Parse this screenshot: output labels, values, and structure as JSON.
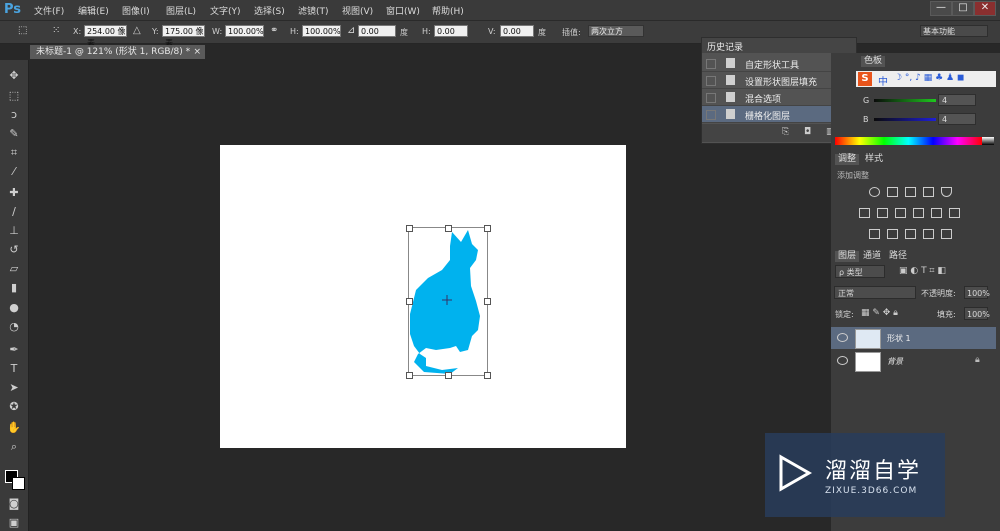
{
  "app": {
    "logo": "Ps"
  },
  "menu": {
    "items": [
      "文件(F)",
      "编辑(E)",
      "图像(I)",
      "图层(L)",
      "文字(Y)",
      "选择(S)",
      "滤镜(T)",
      "视图(V)",
      "窗口(W)",
      "帮助(H)"
    ]
  },
  "window_controls": {
    "min": "—",
    "max": "□",
    "close": "✕"
  },
  "options": {
    "x_label": "X:",
    "x_value": "254.00 像素",
    "y_label": "Y:",
    "y_value": "175.00 像素",
    "w_label": "W:",
    "w_value": "100.00%",
    "h_label": "H:",
    "h_value": "100.00%",
    "angle_value": "0.00",
    "angle_unit": "度",
    "hskew_label": "H:",
    "hskew_value": "0.00",
    "vskew_label": "V:",
    "vskew_value": "0.00",
    "skew_unit": "度",
    "interp_label": "插值:",
    "interp_value": "两次立方",
    "workspace": "基本功能"
  },
  "document": {
    "tab_title": "未标题-1 @ 121% (形状 1, RGB/8) *",
    "tab_close": "×"
  },
  "tools": [
    "move-tool-icon",
    "marquee-tool-icon",
    "lasso-tool-icon",
    "quick-select-tool-icon",
    "crop-tool-icon",
    "eyedropper-tool-icon",
    "healing-brush-tool-icon",
    "brush-tool-icon",
    "stamp-tool-icon",
    "history-brush-tool-icon",
    "eraser-tool-icon",
    "gradient-tool-icon",
    "blur-tool-icon",
    "dodge-tool-icon",
    "pen-tool-icon",
    "type-tool-icon",
    "path-select-tool-icon",
    "shape-tool-icon",
    "hand-tool-icon",
    "zoom-tool-icon"
  ],
  "history": {
    "title": "历史记录",
    "items": [
      "自定形状工具",
      "设置形状图层填充",
      "混合选项",
      "栅格化图层"
    ],
    "selected_index": 3
  },
  "color_panel": {
    "tab": "色板",
    "g_label": "G",
    "g_value": "4",
    "b_label": "B",
    "b_value": "4",
    "ime": {
      "logo": "S",
      "lang": "中"
    }
  },
  "adjustments": {
    "tab": "调整",
    "tab2": "样式",
    "subtitle": "添加调整"
  },
  "layers_panel": {
    "tabs": [
      "图层",
      "通道",
      "路径"
    ],
    "filter": "ρ 类型",
    "blend_mode": "正常",
    "opacity_label": "不透明度:",
    "opacity_value": "100%",
    "lock_label": "锁定:",
    "fill_label": "填充:",
    "fill_value": "100%",
    "layers": [
      {
        "name": "形状 1",
        "selected": true
      },
      {
        "name": "背景",
        "selected": false
      }
    ]
  },
  "colors": {
    "accent": "#4aa3df",
    "shape": "#00b2ee",
    "selected_row": "#5b6a80"
  },
  "watermark": {
    "title": "溜溜自学",
    "url": "ZIXUE.3D66.COM"
  }
}
